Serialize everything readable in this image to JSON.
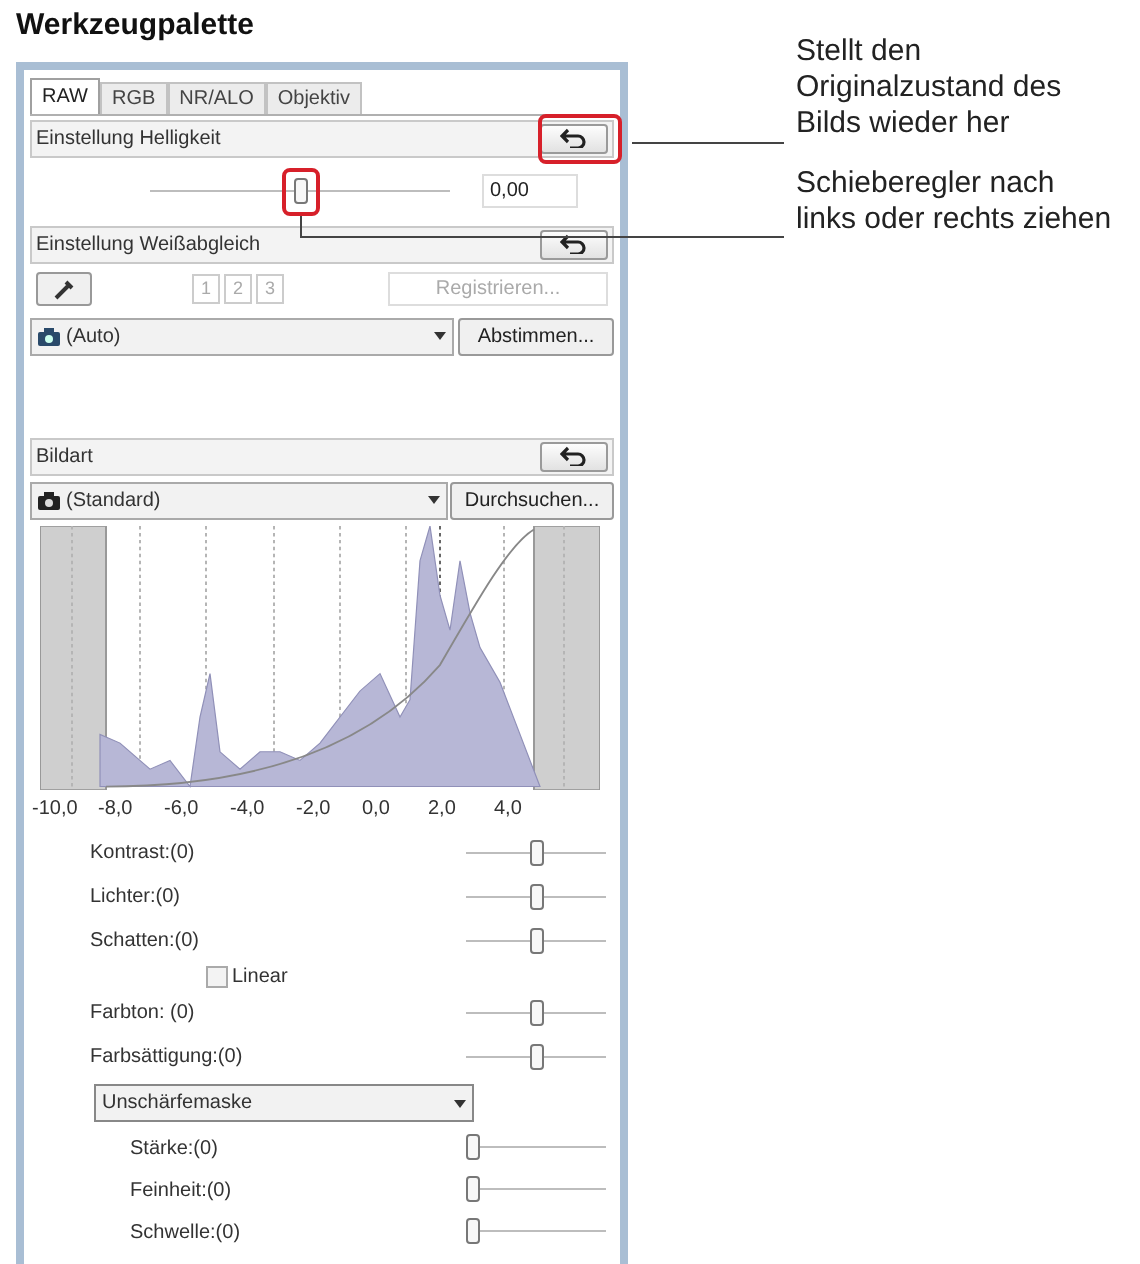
{
  "title": "Werkzeugpalette",
  "tabs": [
    {
      "label": "RAW",
      "selected": true
    },
    {
      "label": "RGB",
      "selected": false
    },
    {
      "label": "NR/ALO",
      "selected": false
    },
    {
      "label": "Objektiv",
      "selected": false
    }
  ],
  "brightness": {
    "header": "Einstellung Helligkeit",
    "level": 0.5,
    "value": "0,00"
  },
  "white_balance": {
    "header": "Einstellung Weißabgleich",
    "presets": [
      "1",
      "2",
      "3"
    ],
    "register_button": {
      "label": "Registrieren...",
      "disabled": true
    },
    "mode": "(Auto)",
    "adjust_button": "Abstimmen..."
  },
  "picture_style": {
    "header": "Bildart",
    "style": "(Standard)",
    "browse_button": "Durchsuchen...",
    "histogram_axis": [
      "-10,0",
      "-8,0",
      "-6,0",
      "-4,0",
      "-2,0",
      "0,0",
      "2,0",
      "4,0"
    ],
    "controls": [
      {
        "kind": "slider",
        "label": "Kontrast:(0)",
        "level": 0.5
      },
      {
        "kind": "slider",
        "label": "Lichter:(0)",
        "level": 0.5
      },
      {
        "kind": "slider",
        "label": "Schatten:(0)",
        "level": 0.5
      },
      {
        "kind": "checkbox",
        "label": "Linear",
        "checked": false
      },
      {
        "kind": "slider",
        "label": "Farbton: (0)",
        "level": 0.5
      },
      {
        "kind": "slider",
        "label": "Farbsättigung:(0)",
        "level": 0.5
      },
      {
        "kind": "dropdown",
        "label": "Unschärfemaske"
      },
      {
        "kind": "subslider",
        "label": "Stärke:(0)",
        "level": 0
      },
      {
        "kind": "subslider",
        "label": "Feinheit:(0)",
        "level": 0
      },
      {
        "kind": "subslider",
        "label": "Schwelle:(0)",
        "level": 0
      }
    ]
  },
  "callouts": [
    {
      "text": "Stellt den Originalzustand des Bilds wieder her"
    },
    {
      "text": "Schieberegler nach links oder rechts ziehen"
    }
  ]
}
